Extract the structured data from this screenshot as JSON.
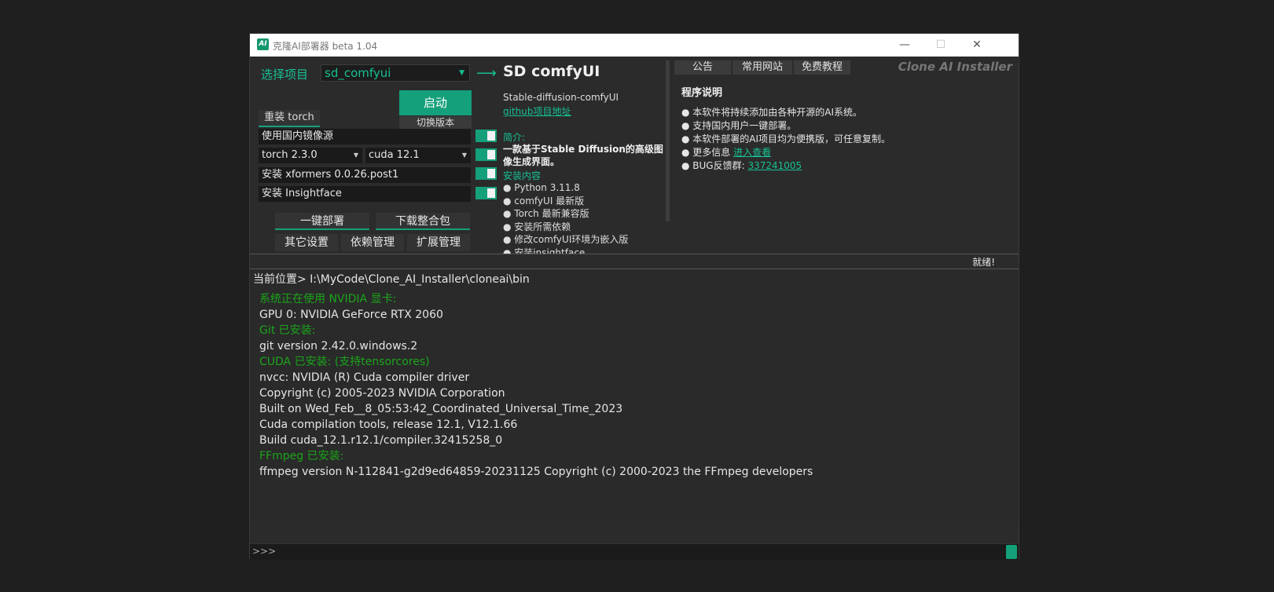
{
  "window": {
    "title": "克隆AI部署器 beta 1.04",
    "icon_text": "AI",
    "minimize": "—",
    "maximize": "☐",
    "close": "✕"
  },
  "left": {
    "project_label": "选择项目",
    "project_value": "sd_comfyui",
    "arrow": "⟶",
    "start_button": "启动",
    "switch_version_button": "切换版本",
    "reinstall_torch_button": "重装 torch",
    "use_mirror_label": "使用国内镜像源",
    "torch_version": "torch 2.3.0",
    "cuda_version": "cuda 12.1",
    "xformers_label": "安装 xformers 0.0.26.post1",
    "insightface_label": "安装 Insightface",
    "one_click_deploy_button": "一键部署",
    "download_package_button": "下载整合包",
    "other_settings_button": "其它设置",
    "deps_manage_button": "依赖管理",
    "ext_manage_button": "扩展管理"
  },
  "info": {
    "title": "SD comfyUI",
    "subtitle": "Stable-diffusion-comfyUI",
    "github_link": "github项目地址",
    "intro_heading": "简介:",
    "intro_text": "一款基于Stable Diffusion的高级图像生成界面。",
    "install_heading": "安装内容",
    "install_items": [
      "● Python 3.11.8",
      "● comfyUI 最新版",
      "● Torch 最新兼容版",
      "● 安装所需依赖",
      "● 修改comfyUI环境为嵌入版",
      "● 安装insightface"
    ]
  },
  "right": {
    "tabs": [
      "公告",
      "常用网站",
      "免费教程"
    ],
    "brand": "Clone AI Installer",
    "heading": "程序说明",
    "lines": [
      "● 本软件将持续添加由各种开源的AI系统。",
      "● 支持国内用户一键部署。",
      "● 本软件部署的AI项目均为便携版，可任意复制。"
    ],
    "more_info_prefix": "● 更多信息 ",
    "more_info_link": "进入查看",
    "bug_prefix": "● BUG反馈群: ",
    "bug_link": "337241005"
  },
  "status": {
    "text": "就绪!"
  },
  "terminal": {
    "cwd": "当前位置> I:\\MyCode\\Clone_AI_Installer\\cloneai\\bin",
    "lines": [
      {
        "text": "系统正在使用 NVIDIA 显卡:",
        "color": "green"
      },
      {
        "text": "GPU 0: NVIDIA GeForce RTX 2060",
        "color": "white"
      },
      {
        "text": "Git 已安装:",
        "color": "green"
      },
      {
        "text": "git version 2.42.0.windows.2",
        "color": "white"
      },
      {
        "text": "CUDA 已安装: (支持tensorcores)",
        "color": "green"
      },
      {
        "text": "nvcc: NVIDIA (R) Cuda compiler driver",
        "color": "white"
      },
      {
        "text": "Copyright (c) 2005-2023 NVIDIA Corporation",
        "color": "white"
      },
      {
        "text": "Built on Wed_Feb__8_05:53:42_Coordinated_Universal_Time_2023",
        "color": "white"
      },
      {
        "text": "Cuda compilation tools, release 12.1, V12.1.66",
        "color": "white"
      },
      {
        "text": "Build cuda_12.1.r12.1/compiler.32415258_0",
        "color": "white"
      },
      {
        "text": "FFmpeg 已安装:",
        "color": "green"
      },
      {
        "text": "ffmpeg version N-112841-g2d9ed64859-20231125 Copyright (c) 2000-2023 the FFmpeg developers",
        "color": "white"
      }
    ],
    "prompt": ">>>"
  },
  "colors": {
    "accent": "#14a07a",
    "log_green": "#1ba51b",
    "background": "#2b2b2b"
  }
}
